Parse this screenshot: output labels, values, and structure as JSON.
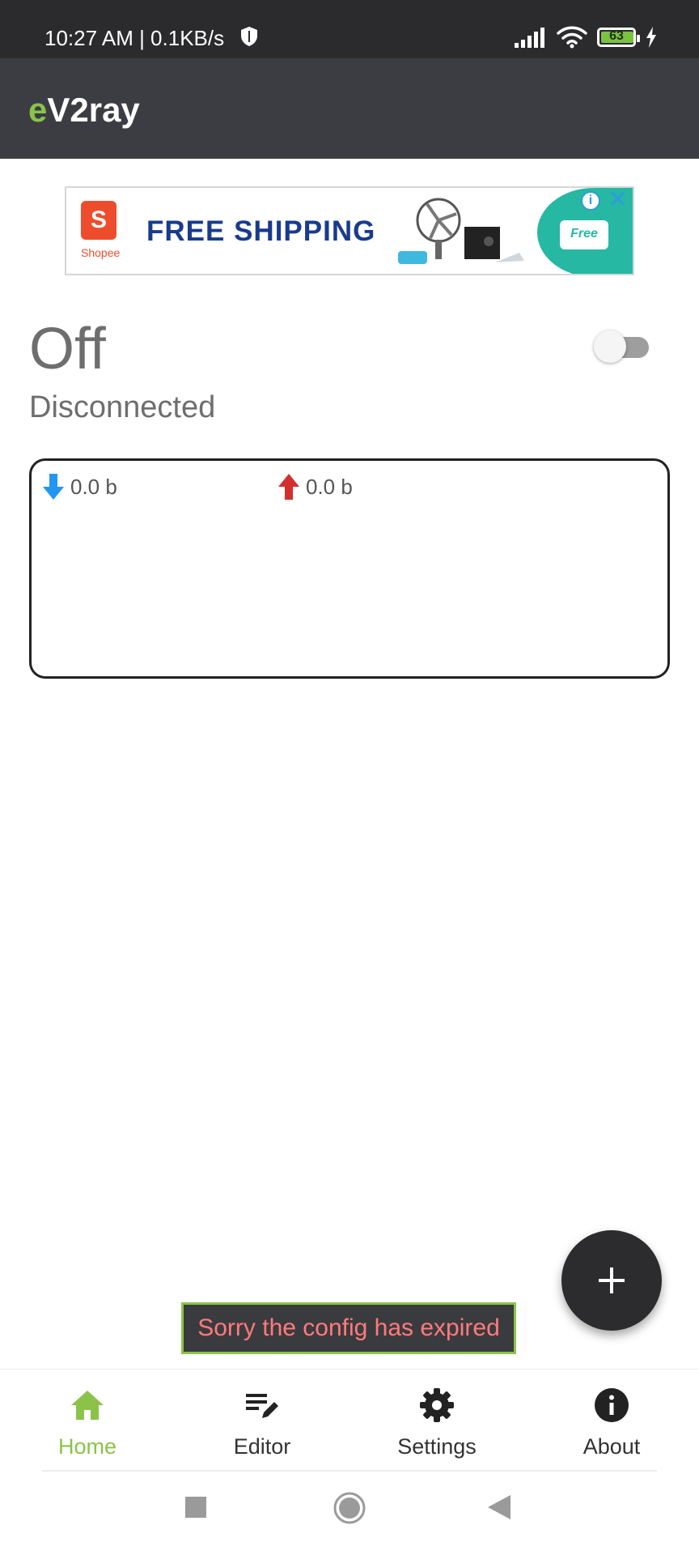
{
  "status_bar": {
    "time_speed": "10:27 AM | 0.1KB/s",
    "battery": "63"
  },
  "app_bar": {
    "title_accent": "e",
    "title_rest": "V2ray"
  },
  "ad": {
    "brand": "Shopee",
    "logo_letter": "S",
    "headline": "FREE SHIPPING",
    "badge": "Free",
    "info": "i",
    "close": "✕"
  },
  "connection": {
    "state": "Off",
    "status": "Disconnected",
    "toggle_on": false
  },
  "traffic": {
    "download": "0.0 b",
    "upload": "0.0 b"
  },
  "snackbar": {
    "message": "Sorry the config has expired"
  },
  "bottom_nav": {
    "items": [
      {
        "label": "Home",
        "icon": "home-icon",
        "active": true
      },
      {
        "label": "Editor",
        "icon": "edit-icon",
        "active": false
      },
      {
        "label": "Settings",
        "icon": "gear-icon",
        "active": false
      },
      {
        "label": "About",
        "icon": "info-icon",
        "active": false
      }
    ]
  },
  "colors": {
    "accent": "#8bc34a",
    "app_bar": "#3c3d42",
    "status_bar": "#2b2b2d",
    "download_arrow": "#2196f3",
    "upload_arrow": "#d32f2f",
    "snackbar_text": "#ff7b7b"
  }
}
